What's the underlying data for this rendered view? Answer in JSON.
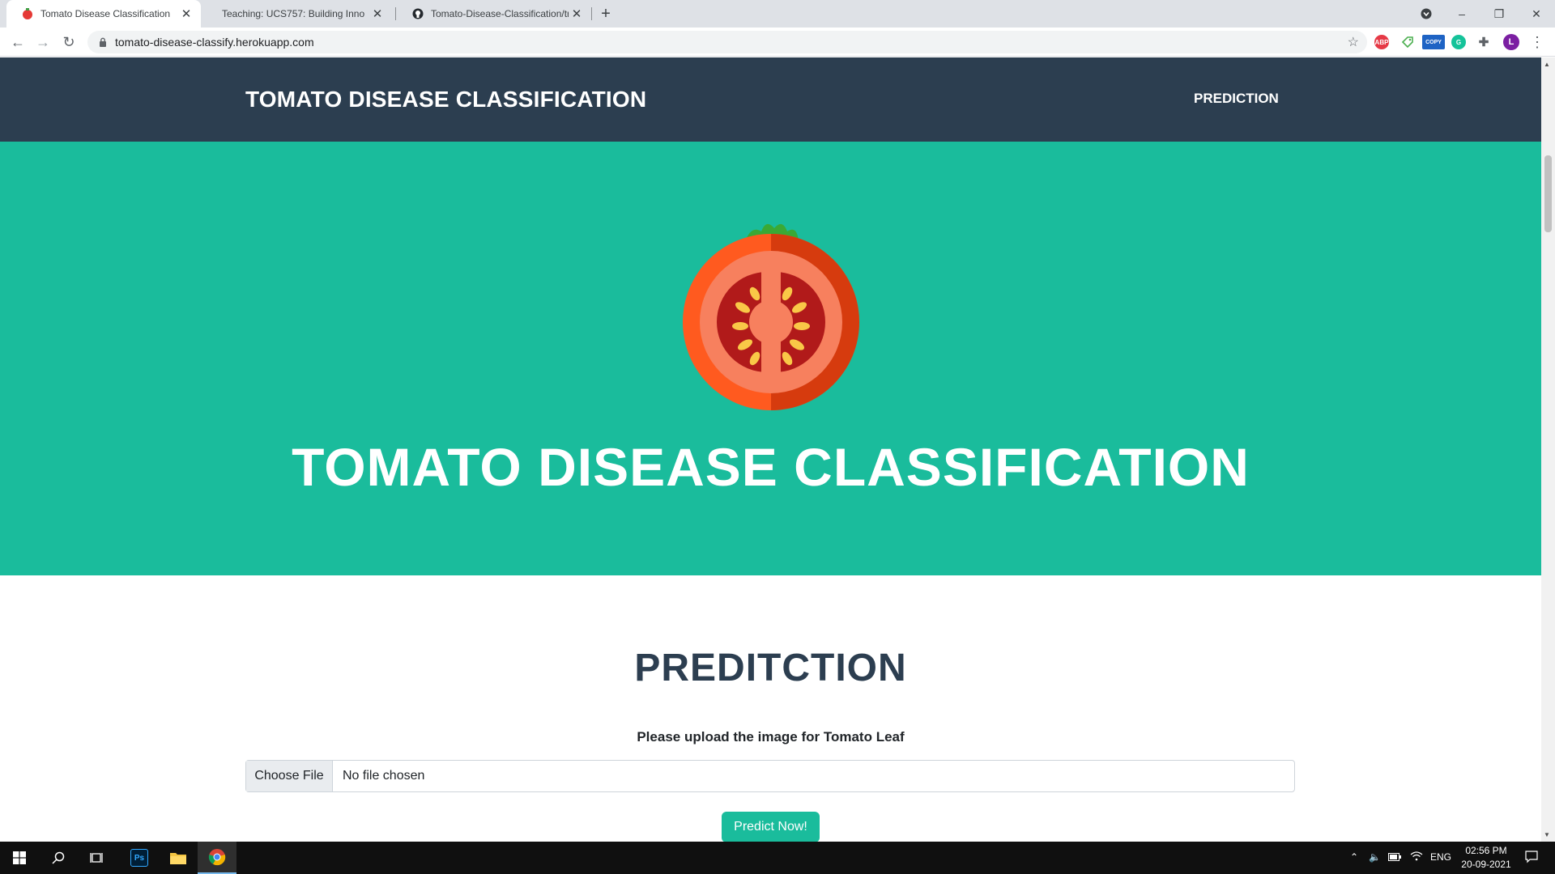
{
  "browser": {
    "tabs": [
      {
        "title": "Tomato Disease Classification",
        "active": true,
        "icon": "tomato-icon"
      },
      {
        "title": "Teaching: UCS757: Building Inno",
        "active": false,
        "icon": "none"
      },
      {
        "title": "Tomato-Disease-Classification/tr",
        "active": false,
        "icon": "github-icon"
      }
    ],
    "url": "tomato-disease-classify.herokuapp.com",
    "extensions": [
      {
        "name": "abp-icon",
        "label": "ABP",
        "color": "#e63946"
      },
      {
        "name": "tag-icon",
        "label": "",
        "color": "#4caf50"
      },
      {
        "name": "copy-icon",
        "label": "COPY",
        "color": "#1e63c4"
      },
      {
        "name": "grammarly-icon",
        "label": "G",
        "color": "#15c39a"
      },
      {
        "name": "puzzle-icon",
        "label": "",
        "color": "#5f6368"
      },
      {
        "name": "profile-avatar",
        "label": "L",
        "color": "#7b1fa2"
      }
    ]
  },
  "navbar": {
    "brand": "TOMATO DISEASE CLASSIFICATION",
    "link": "PREDICTION"
  },
  "hero": {
    "title": "TOMATO DISEASE CLASSIFICATION",
    "background_color": "#1abc9c"
  },
  "prediction": {
    "title": "PREDITCTION",
    "upload_label": "Please upload the image for Tomato Leaf",
    "choose_file": "Choose File",
    "no_file": "No file chosen",
    "button": "Predict Now!"
  },
  "taskbar": {
    "apps": [
      "windows-start-icon",
      "search-icon",
      "task-view-icon",
      "photoshop-icon",
      "file-explorer-icon",
      "chrome-icon"
    ],
    "language": "ENG",
    "time": "02:56 PM",
    "date": "20-09-2021"
  },
  "colors": {
    "navbar": "#2c3e50",
    "accent": "#1abc9c",
    "heading": "#2c3e50"
  }
}
